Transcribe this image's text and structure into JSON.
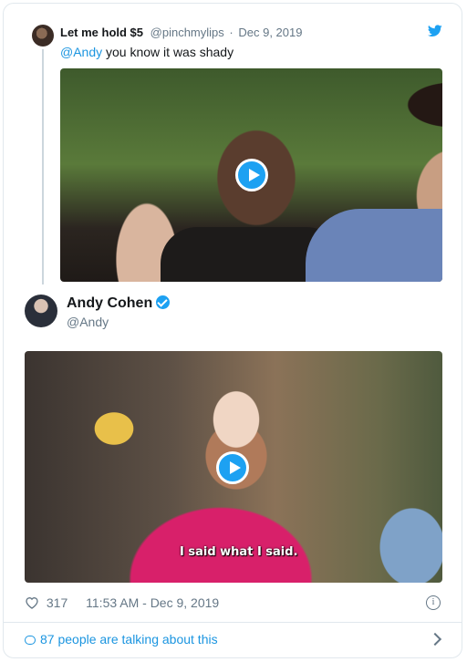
{
  "quoted_tweet": {
    "name": "Let me hold $5",
    "handle": "@pinchmylips",
    "date": "Dec 9, 2019",
    "mention": "@Andy",
    "text": "you know it was shady"
  },
  "main_tweet": {
    "name": "Andy Cohen",
    "handle": "@Andy",
    "video_caption": "I said what I said.",
    "likes": "317",
    "timestamp": "11:53 AM - Dec 9, 2019"
  },
  "footer": {
    "talking": "87 people are talking about this"
  },
  "colors": {
    "accent": "#1da1f2",
    "link": "#1b95e0",
    "muted": "#657786"
  },
  "icons": [
    "twitter-bird-icon",
    "play-icon",
    "verified-badge-icon",
    "heart-icon",
    "info-icon",
    "comment-bubble-icon",
    "chevron-right-icon"
  ]
}
